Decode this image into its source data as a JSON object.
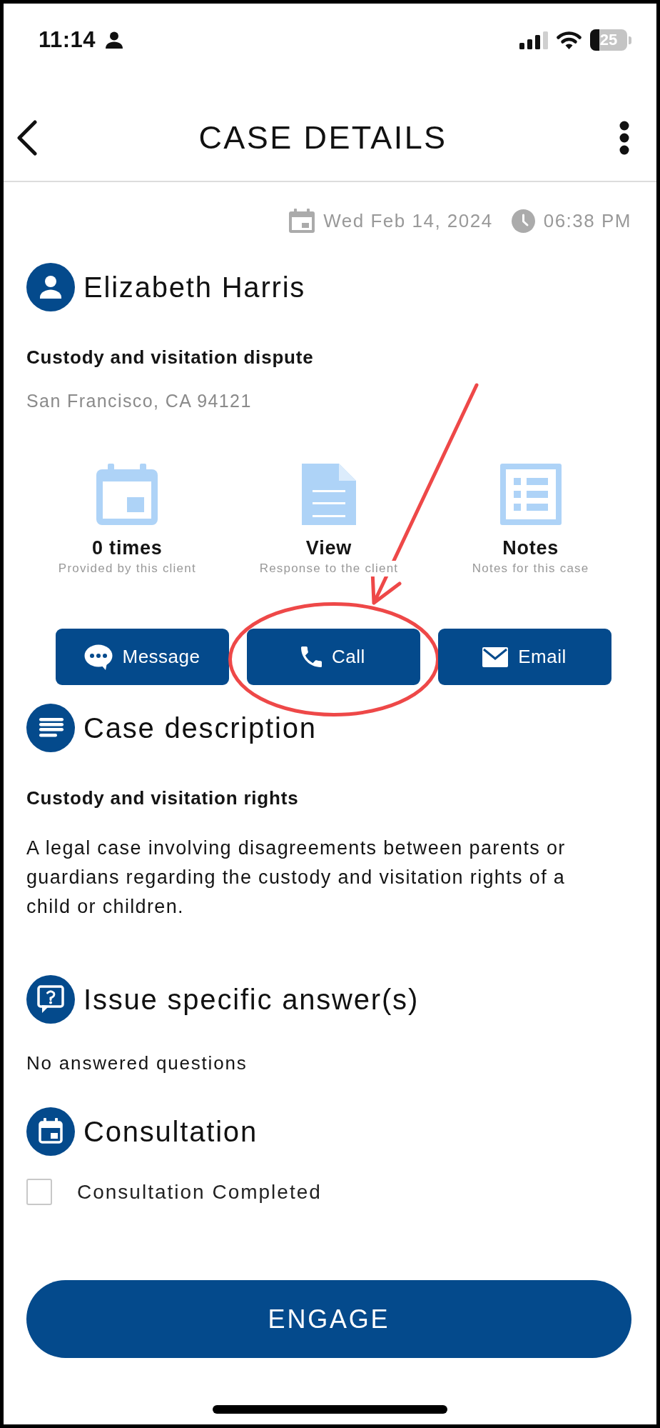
{
  "status_bar": {
    "time": "11:14",
    "battery_percent": "25"
  },
  "header": {
    "title": "CASE DETAILS"
  },
  "timestamp": {
    "date": "Wed Feb 14, 2024",
    "time": "06:38 PM"
  },
  "client": {
    "name": "Elizabeth Harris",
    "case_type": "Custody and visitation dispute",
    "location": "San Francisco, CA 94121"
  },
  "stats": [
    {
      "kind": "calendar",
      "value": "0 times",
      "caption": "Provided by this client"
    },
    {
      "kind": "document",
      "value": "View",
      "caption": "Response to the client"
    },
    {
      "kind": "list",
      "value": "Notes",
      "caption": "Notes for this case"
    }
  ],
  "actions": [
    {
      "kind": "message",
      "label": "Message",
      "highlighted": false
    },
    {
      "kind": "call",
      "label": "Call",
      "highlighted": true
    },
    {
      "kind": "email",
      "label": "Email",
      "highlighted": false
    }
  ],
  "sections": [
    {
      "kind": "description",
      "title": "Case description",
      "subtitle": "Custody and visitation rights",
      "body": "A legal case involving disagreements between parents or guardians regarding the custody and visitation rights of a child or children."
    },
    {
      "kind": "questions",
      "title": "Issue specific answer(s)",
      "body": "No answered questions"
    },
    {
      "kind": "consultation",
      "title": "Consultation",
      "checkbox": {
        "label": "Consultation Completed",
        "checked": false
      }
    }
  ],
  "engage_button": {
    "label": "ENGAGE"
  }
}
